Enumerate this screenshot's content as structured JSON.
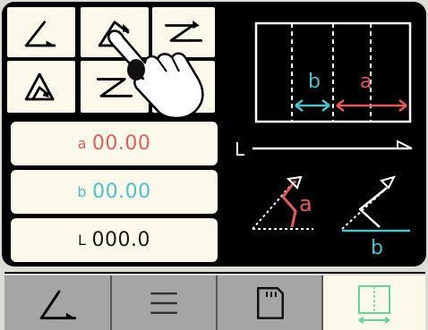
{
  "colors": {
    "screen_bg": "#000000",
    "button_bg": "#fbf9e9",
    "a_color": "#e25d5a",
    "b_color": "#4fc0cc",
    "tab_bg": "#a5a5a5",
    "tab_active_icon": "#6ad19a"
  },
  "mode_buttons": [
    {
      "icon": "angle-icon"
    },
    {
      "icon": "angle-selected-icon"
    },
    {
      "icon": "zigzag-icon"
    },
    {
      "icon": "triangle-angle-icon"
    },
    {
      "icon": "z-shape-icon"
    },
    {
      "icon": "angle-arrow-icon"
    }
  ],
  "fields": {
    "a": {
      "label": "a",
      "value": "00.00"
    },
    "b": {
      "label": "b",
      "value": "00.00"
    },
    "L": {
      "label": "L",
      "value": "000.0"
    }
  },
  "diagram": {
    "b_label": "b",
    "a_label": "a",
    "L_label": "L",
    "angle_a_label": "a",
    "angle_b_label": "b"
  },
  "tabs": [
    {
      "name": "angle",
      "icon": "angle-icon",
      "active": false
    },
    {
      "name": "menu",
      "icon": "menu-icon",
      "active": false
    },
    {
      "name": "sd-card",
      "icon": "sd-card-icon",
      "active": false
    },
    {
      "name": "measure",
      "icon": "measure-frame-icon",
      "active": true
    }
  ]
}
